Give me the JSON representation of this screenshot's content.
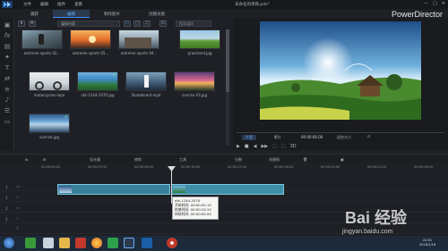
{
  "app": {
    "menu": [
      "文件",
      "编辑",
      "插件",
      "查看"
    ],
    "window_title": "未命名的项目.pds*",
    "brand": "PowerDirector",
    "window_buttons": [
      "—",
      "□",
      "✕"
    ]
  },
  "tabs": [
    {
      "label": "捕获",
      "active": false
    },
    {
      "label": "编辑",
      "active": true
    },
    {
      "label": "制作影片",
      "active": false
    },
    {
      "label": "创建光盘",
      "active": false
    }
  ],
  "library": {
    "filter": "媒体内容",
    "search_placeholder": "搜索媒体",
    "items": [
      {
        "name": "extreme sports 02...",
        "checked": false,
        "scene": "climb"
      },
      {
        "name": "extreme sports 05...",
        "checked": false,
        "scene": "bike-sunset"
      },
      {
        "name": "extreme sports 04...",
        "checked": false,
        "scene": "cliff"
      },
      {
        "name": "grassland.jpg",
        "checked": true,
        "scene": "grass"
      },
      {
        "name": "motorcycles.mpo",
        "checked": false,
        "scene": "moto"
      },
      {
        "name": "ntk-1244-2070.jpg",
        "checked": true,
        "scene": "river"
      },
      {
        "name": "Skateboard.mp4",
        "checked": false,
        "scene": "skate"
      },
      {
        "name": "sunrise 03.jpg",
        "checked": false,
        "scene": "sunrise-pink"
      },
      {
        "name": "sunrise.jpg",
        "checked": true,
        "scene": "sunrise-blue"
      }
    ]
  },
  "preview": {
    "mode_clip": "片段",
    "mode_movie": "影片",
    "timecode": "00:00:00.00",
    "fit": "适合大小",
    "controls": [
      "▶",
      "■",
      "◀",
      "▶▶",
      "⬚",
      "⬚",
      "3D"
    ]
  },
  "timeline_toolbar": {
    "items": [
      "设计器",
      "修剪",
      "工具",
      "分割",
      "关键帧"
    ]
  },
  "ruler": [
    "00:00:00:00",
    "00:00:03:10",
    "00:00:06:20",
    "00:00:10:00",
    "00:00:13:10",
    "00:00:16:20",
    "00:00:20:00",
    "00:00:23:10",
    "00:00:26:20"
  ],
  "tracks": [
    {
      "num": "1."
    },
    {
      "num": "1."
    },
    {
      "num": "2."
    },
    {
      "num": "2."
    },
    {
      "num": ""
    }
  ],
  "tooltip": {
    "lines": [
      "ntk-1244-2070",
      "开始时间: 00:00:05.15",
      "结束时间: 00:00:10.15",
      "持续时间: 00:00:05.00"
    ]
  },
  "taskbar": {
    "time": "22:01",
    "date": "2016/1/16"
  },
  "watermark": {
    "logo": "Bai 经验",
    "url": "jingyan.baidu.com"
  },
  "colors": {
    "accent": "#3d8bff",
    "clip": "#3a7f99",
    "check": "#8fe06a"
  }
}
